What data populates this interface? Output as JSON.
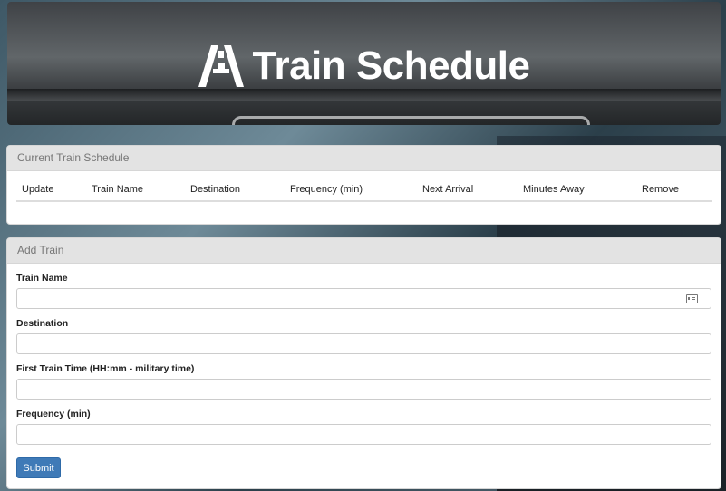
{
  "header": {
    "title": "Train Schedule",
    "logo_icon": "highway-road-icon"
  },
  "schedule": {
    "panel_title": "Current Train Schedule",
    "columns": [
      "Update",
      "Train Name",
      "Destination",
      "Frequency (min)",
      "Next Arrival",
      "Minutes Away",
      "Remove"
    ],
    "rows": []
  },
  "add_train": {
    "panel_title": "Add Train",
    "fields": [
      {
        "label": "Train Name",
        "value": "",
        "placeholder": ""
      },
      {
        "label": "Destination",
        "value": "",
        "placeholder": ""
      },
      {
        "label": "First Train Time (HH:mm - military time)",
        "value": "",
        "placeholder": ""
      },
      {
        "label": "Frequency (min)",
        "value": "",
        "placeholder": ""
      }
    ],
    "submit_label": "Submit"
  },
  "colors": {
    "accent": "#3f7ab7",
    "panel_header": "#e3e3e3"
  }
}
